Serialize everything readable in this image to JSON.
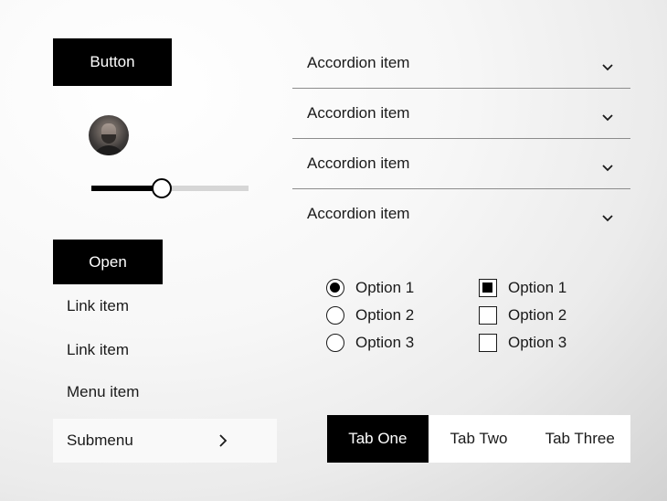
{
  "button": {
    "label": "Button"
  },
  "avatar": {
    "icon": "person-photo-icon"
  },
  "slider": {
    "value": 0.45
  },
  "dropdown": {
    "open_label": "Open",
    "items": [
      {
        "label": "Link item"
      },
      {
        "label": "Link item"
      },
      {
        "label": "Menu item"
      }
    ],
    "submenu": {
      "label": "Submenu",
      "icon": "chevron-right-icon"
    }
  },
  "accordion": {
    "items": [
      {
        "label": "Accordion item",
        "icon": "chevron-down-icon"
      },
      {
        "label": "Accordion item",
        "icon": "chevron-down-icon"
      },
      {
        "label": "Accordion item",
        "icon": "chevron-down-icon"
      },
      {
        "label": "Accordion item",
        "icon": "chevron-down-icon"
      }
    ]
  },
  "radios": {
    "selected": 0,
    "options": [
      {
        "label": "Option 1"
      },
      {
        "label": "Option 2"
      },
      {
        "label": "Option 3"
      }
    ]
  },
  "checkboxes": {
    "options": [
      {
        "label": "Option 1",
        "checked": true
      },
      {
        "label": "Option 2",
        "checked": false
      },
      {
        "label": "Option 3",
        "checked": false
      }
    ]
  },
  "tabs": {
    "active": 0,
    "items": [
      {
        "label": "Tab One"
      },
      {
        "label": "Tab Two"
      },
      {
        "label": "Tab Three"
      }
    ]
  },
  "colors": {
    "accent": "#000000",
    "track": "#d6d6d6",
    "divider": "#8c8c8c"
  }
}
